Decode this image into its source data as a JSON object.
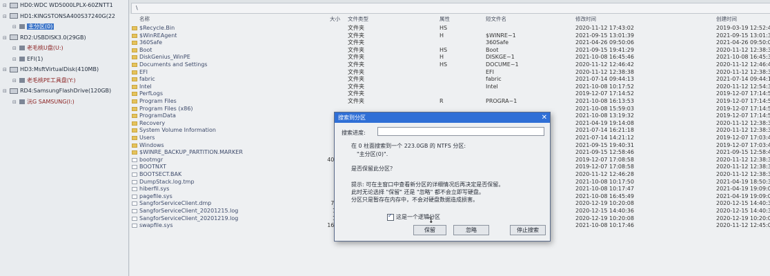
{
  "tree": [
    {
      "label": "HD0:WDC WD5000LPLX-60ZNTT1",
      "level": 0,
      "kind": "disk",
      "style": ""
    },
    {
      "label": "HD1:KINGSTONSA400S37240G(22",
      "level": 0,
      "kind": "disk",
      "style": ""
    },
    {
      "label": "主分区(0)",
      "level": 1,
      "kind": "part",
      "style": "sel"
    },
    {
      "label": "RD2:USBDISK3.0(29GB)",
      "level": 0,
      "kind": "disk",
      "style": ""
    },
    {
      "label": "老毛桃U盘(U:)",
      "level": 1,
      "kind": "part",
      "style": "red"
    },
    {
      "label": "EFI(1)",
      "level": 1,
      "kind": "part",
      "style": ""
    },
    {
      "label": "HD3:MsftVirtualDisk(410MB)",
      "level": 0,
      "kind": "disk",
      "style": ""
    },
    {
      "label": "老毛桃PE工具盘(Y:)",
      "level": 1,
      "kind": "part",
      "style": "red"
    },
    {
      "label": "RD4:SamsungFlashDrive(120GB)",
      "level": 0,
      "kind": "disk",
      "style": ""
    },
    {
      "label": "沅G SAMSUNG(I:)",
      "level": 1,
      "kind": "part",
      "style": "red"
    }
  ],
  "breadcrumb": "\\",
  "columns": {
    "name": "名称",
    "size": "大小",
    "type": "文件类型",
    "attr": "属性",
    "short": "短文件名",
    "modified": "修改时间",
    "created": "创建时间"
  },
  "files": [
    {
      "icon": "folder",
      "name": "$Recycle.Bin",
      "size": "",
      "type": "文件夹",
      "attr": "HS",
      "short": "",
      "mod": "2020-11-12 17:43:02",
      "cre": "2019-03-19 12:52:43"
    },
    {
      "icon": "folder",
      "name": "$WinREAgent",
      "size": "",
      "type": "文件夹",
      "attr": "H",
      "short": "$WINRE~1",
      "mod": "2021-09-15 13:01:39",
      "cre": "2021-09-15 13:01:39"
    },
    {
      "icon": "folder",
      "name": "360Safe",
      "size": "",
      "type": "文件夹",
      "attr": "",
      "short": "360Safe",
      "mod": "2021-04-26 09:50:06",
      "cre": "2021-04-26 09:50:06"
    },
    {
      "icon": "folder",
      "name": "Boot",
      "size": "",
      "type": "文件夹",
      "attr": "HS",
      "short": "Boot",
      "mod": "2021-09-15 19:41:29",
      "cre": "2020-11-12 12:38:38"
    },
    {
      "icon": "folder",
      "name": "DiskGenius_WinPE",
      "size": "",
      "type": "文件夹",
      "attr": "H",
      "short": "DISKGE~1",
      "mod": "2021-10-08 16:45:46",
      "cre": "2021-10-08 16:45:38"
    },
    {
      "icon": "folder",
      "name": "Documents and Settings",
      "size": "",
      "type": "文件夹",
      "attr": "HS",
      "short": "DOCUME~1",
      "mod": "2020-11-12 12:46:42",
      "cre": "2020-11-12 12:46:42"
    },
    {
      "icon": "folder",
      "name": "EFI",
      "size": "",
      "type": "文件夹",
      "attr": "",
      "short": "EFI",
      "mod": "2020-11-12 12:38:38",
      "cre": "2020-11-12 12:38:38"
    },
    {
      "icon": "folder",
      "name": "fabric",
      "size": "",
      "type": "文件夹",
      "attr": "",
      "short": "fabric",
      "mod": "2021-07-14 09:44:13",
      "cre": "2021-07-14 09:44:13"
    },
    {
      "icon": "folder",
      "name": "Intel",
      "size": "",
      "type": "文件夹",
      "attr": "",
      "short": "Intel",
      "mod": "2021-10-08 10:17:52",
      "cre": "2020-11-12 12:54:33"
    },
    {
      "icon": "folder",
      "name": "PerfLogs",
      "size": "",
      "type": "文件夹",
      "attr": "",
      "short": "",
      "mod": "2019-12-07 17:14:52",
      "cre": "2019-12-07 17:14:52"
    },
    {
      "icon": "folder",
      "name": "Program Files",
      "size": "",
      "type": "文件夹",
      "attr": "R",
      "short": "PROGRA~1",
      "mod": "2021-10-08 16:13:53",
      "cre": "2019-12-07 17:14:52"
    },
    {
      "icon": "folder",
      "name": "Program Files (x86)",
      "size": "",
      "type": "",
      "attr": "",
      "short": "",
      "mod": "2021-10-08 15:59:03",
      "cre": "2019-12-07 17:14:52"
    },
    {
      "icon": "folder",
      "name": "ProgramData",
      "size": "",
      "type": "",
      "attr": "",
      "short": "",
      "mod": "2021-10-08 13:19:32",
      "cre": "2019-12-07 17:14:52"
    },
    {
      "icon": "folder",
      "name": "Recovery",
      "size": "",
      "type": "",
      "attr": "",
      "short": "",
      "mod": "2021-04-19 19:14:08",
      "cre": "2020-11-12 12:38:38"
    },
    {
      "icon": "folder",
      "name": "System Volume Information",
      "size": "",
      "type": "",
      "attr": "",
      "short": "",
      "mod": "2021-07-14 16:21:18",
      "cre": "2020-11-12 12:38:38"
    },
    {
      "icon": "folder",
      "name": "Users",
      "size": "",
      "type": "",
      "attr": "",
      "short": "",
      "mod": "2021-07-14 14:21:12",
      "cre": "2019-12-07 17:03:44"
    },
    {
      "icon": "folder",
      "name": "Windows",
      "size": "",
      "type": "",
      "attr": "",
      "short": "",
      "mod": "2021-09-15 19:40:31",
      "cre": "2019-12-07 17:03:44"
    },
    {
      "icon": "folder",
      "name": "$WINRE_BACKUP_PARTITION.MARKER",
      "size": "",
      "type": "",
      "attr": "",
      "short": "",
      "mod": "2021-09-15 12:58:46",
      "cre": "2021-09-15 12:58:46"
    },
    {
      "icon": "file",
      "name": "bootmgr",
      "size": "404.",
      "type": "",
      "attr": "",
      "short": "",
      "mod": "2019-12-07 17:08:58",
      "cre": "2020-11-12 12:38:38"
    },
    {
      "icon": "file",
      "name": "BOOTNXT",
      "size": "",
      "type": "",
      "attr": "",
      "short": "",
      "mod": "2019-12-07 17:08:58",
      "cre": "2020-11-12 12:38:38"
    },
    {
      "icon": "file",
      "name": "BOOTSECT.BAK",
      "size": "8.",
      "type": "",
      "attr": "",
      "short": "",
      "mod": "2020-11-12 12:46:28",
      "cre": "2020-11-12 12:38:38"
    },
    {
      "icon": "file",
      "name": "DumpStack.log.tmp",
      "size": "8.",
      "type": "",
      "attr": "",
      "short": "",
      "mod": "2021-10-08 10:17:50",
      "cre": "2021-04-19 18:50:30"
    },
    {
      "icon": "file",
      "name": "hiberfil.sys",
      "size": "6.",
      "type": "",
      "attr": "",
      "short": "",
      "mod": "2021-10-08 10:17:47",
      "cre": "2021-04-19 19:09:06"
    },
    {
      "icon": "file",
      "name": "pagefile.sys",
      "size": "4.",
      "type": "",
      "attr": "",
      "short": "",
      "mod": "2021-10-08 16:45:49",
      "cre": "2021-04-19 19:09:06"
    },
    {
      "icon": "file",
      "name": "SangforServiceClient.dmp",
      "size": "72.",
      "type": "",
      "attr": "",
      "short": "",
      "mod": "2020-12-19 10:20:08",
      "cre": "2020-12-15 14:40:35"
    },
    {
      "icon": "file",
      "name": "SangforServiceClient_20201215.log",
      "size": "19",
      "type": "",
      "attr": "",
      "short": "",
      "mod": "2020-12-15 14:40:36",
      "cre": "2020-12-15 14:40:36"
    },
    {
      "icon": "file",
      "name": "SangforServiceClient_20201219.log",
      "size": "19",
      "type": "",
      "attr": "",
      "short": "",
      "mod": "2020-12-19 10:20:08",
      "cre": "2020-12-19 10:20:08"
    },
    {
      "icon": "file",
      "name": "swapfile.sys",
      "size": "16.0",
      "type": "",
      "attr": "",
      "short": "",
      "mod": "2021-10-08 10:17:46",
      "cre": "2020-11-12 12:45:00"
    }
  ],
  "dialog": {
    "title": "搜索到分区",
    "close": "✕",
    "progress_label": "搜索进度:",
    "found_line1": "在 0 柱面搜索到一个 223.0GB 的 NTFS 分区:",
    "found_line2": "\"主分区(0)\".",
    "question": "是否保留此分区？",
    "hint1": "提示: 可在主窗口中查看新分区的详细情况后再决定是否保留。",
    "hint2": "此时无论选择 \"保留\" 还是 \"忽略\" 都不会立即写硬盘。",
    "hint3": "分区只是暂存在内存中，不会对硬盘数据造成损害。",
    "checkbox": "这是一个逻辑分区",
    "keep": "保留",
    "ignore": "忽略",
    "stop": "停止搜索"
  }
}
